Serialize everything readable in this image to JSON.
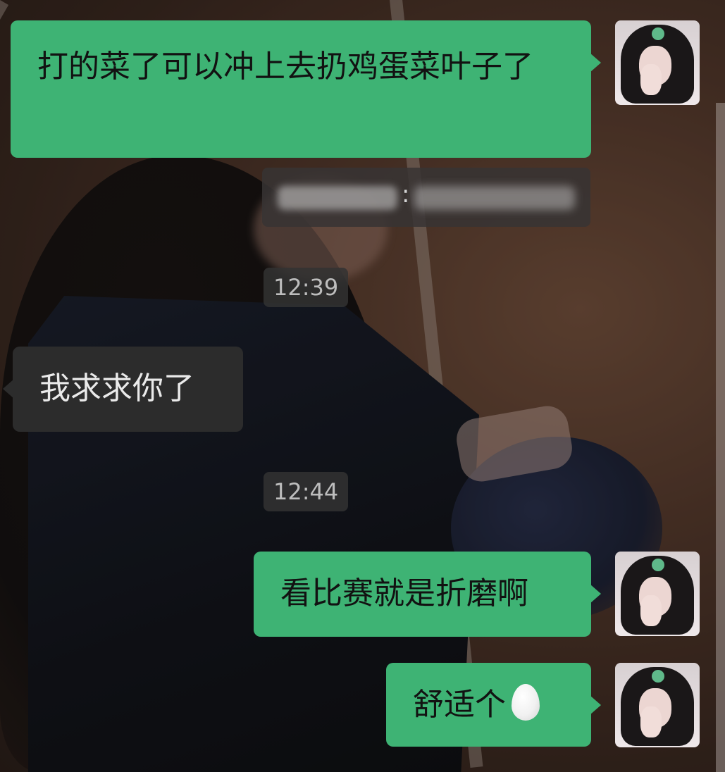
{
  "messages": [
    {
      "id": "m1",
      "side": "out",
      "text": "打的菜了可以冲上去扔鸡蛋菜叶子了"
    },
    {
      "id": "m2",
      "side": "in",
      "text": "我求求你了"
    },
    {
      "id": "m3",
      "side": "out",
      "text": "看比赛就是折磨啊"
    },
    {
      "id": "m4",
      "side": "out",
      "text": "舒适个",
      "emoji": "egg-emoji"
    }
  ],
  "notice": {
    "separator": ":"
  },
  "timestamps": [
    "12:39",
    "12:44"
  ],
  "colors": {
    "outgoing_bubble": "#3eb374",
    "incoming_bubble": "#2c2c2c",
    "timestamp_chip": "#323232"
  }
}
